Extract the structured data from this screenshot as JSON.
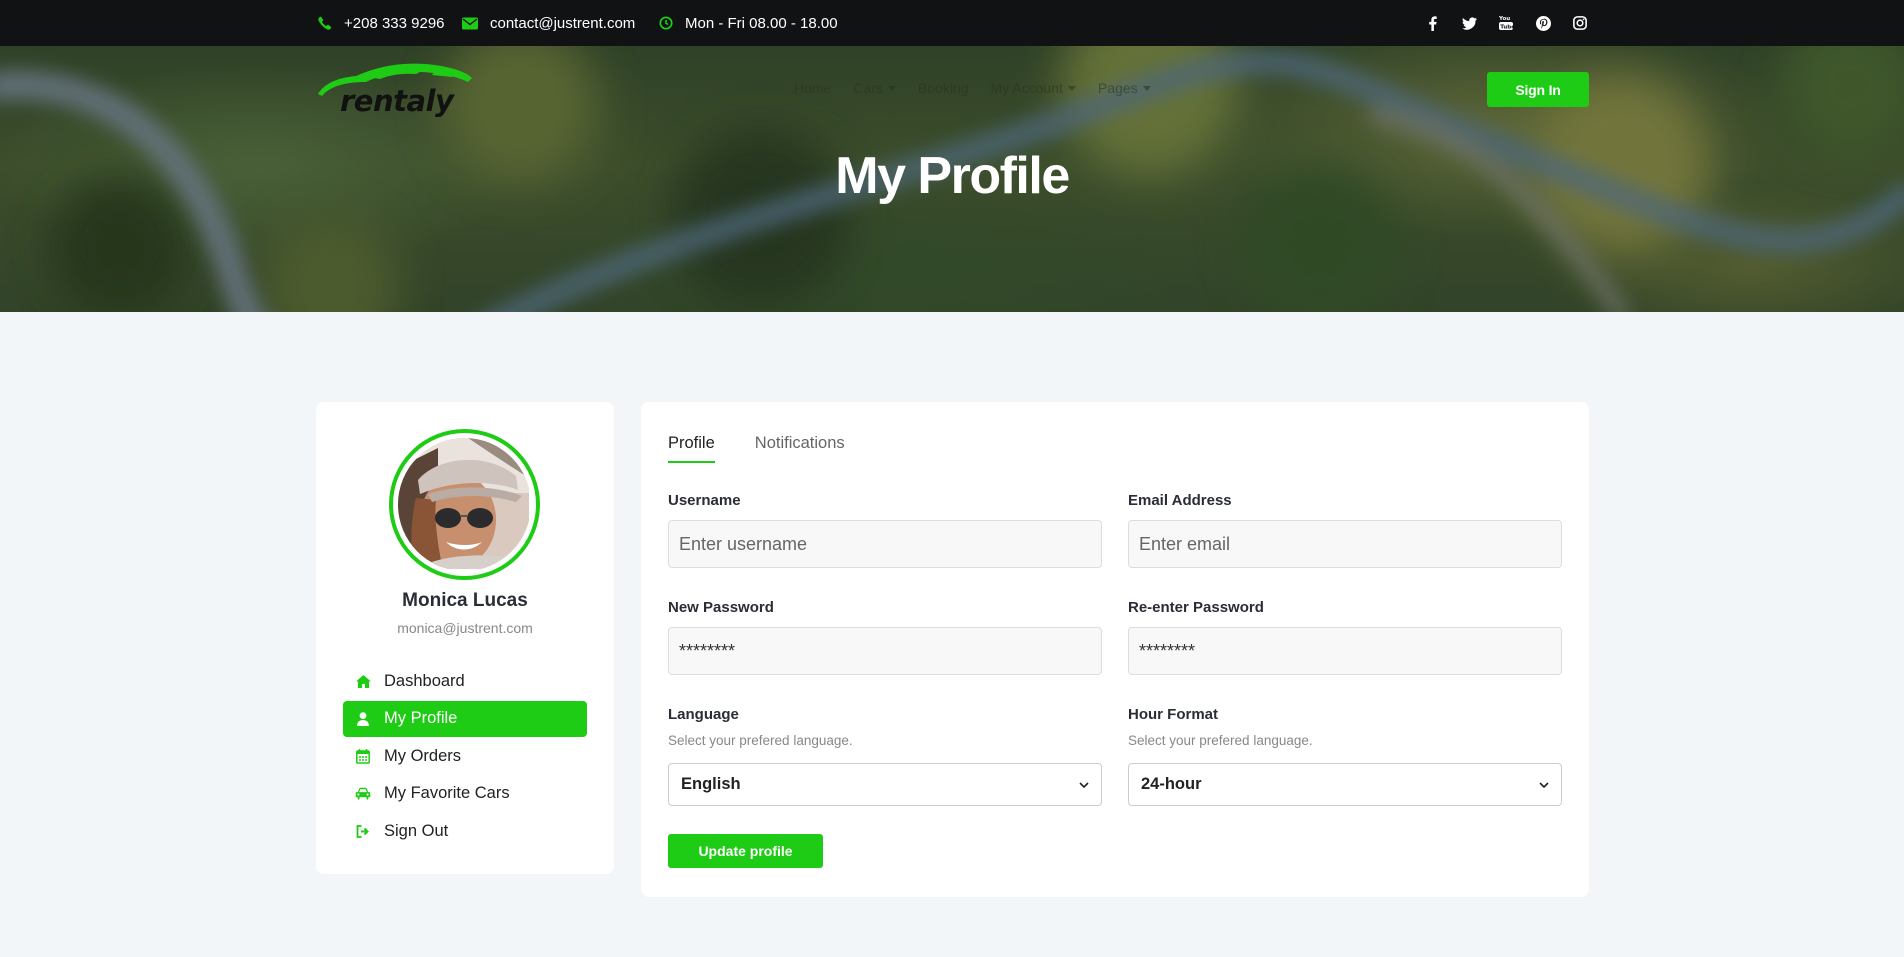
{
  "topbar": {
    "phone": "+208 333 9296",
    "email": "contact@justrent.com",
    "hours": "Mon - Fri 08.00 - 18.00",
    "social_icons": [
      "facebook-icon",
      "twitter-icon",
      "youtube-icon",
      "pinterest-icon",
      "instagram-icon"
    ]
  },
  "header": {
    "logo_text": "rentaly",
    "nav": [
      {
        "label": "Home",
        "has_dropdown": false
      },
      {
        "label": "Cars",
        "has_dropdown": true
      },
      {
        "label": "Booking",
        "has_dropdown": false
      },
      {
        "label": "My Account",
        "has_dropdown": true
      },
      {
        "label": "Pages",
        "has_dropdown": true
      }
    ],
    "signin_label": "Sign In",
    "page_title": "My Profile"
  },
  "sidebar": {
    "user_name": "Monica Lucas",
    "user_email": "monica@justrent.com",
    "items": [
      {
        "label": "Dashboard",
        "icon": "home-icon",
        "active": false
      },
      {
        "label": "My Profile",
        "icon": "user-icon",
        "active": true
      },
      {
        "label": "My Orders",
        "icon": "calendar-icon",
        "active": false
      },
      {
        "label": "My Favorite Cars",
        "icon": "car-icon",
        "active": false
      },
      {
        "label": "Sign Out",
        "icon": "sign-out-icon",
        "active": false
      }
    ]
  },
  "profile": {
    "tabs": [
      {
        "label": "Profile",
        "active": true
      },
      {
        "label": "Notifications",
        "active": false
      }
    ],
    "username": {
      "label": "Username",
      "placeholder": "Enter username",
      "value": ""
    },
    "email": {
      "label": "Email Address",
      "placeholder": "Enter email",
      "value": ""
    },
    "new_password": {
      "label": "New Password",
      "value": "********"
    },
    "reenter_password": {
      "label": "Re-enter Password",
      "value": "********"
    },
    "language": {
      "label": "Language",
      "hint": "Select your prefered language.",
      "selected": "English"
    },
    "hour_format": {
      "label": "Hour Format",
      "hint": "Select your prefered language.",
      "selected": "24-hour"
    },
    "update_label": "Update profile"
  },
  "colors": {
    "accent": "#1ecb15",
    "topbar_bg": "#111214",
    "page_bg": "#f3f6f9"
  }
}
